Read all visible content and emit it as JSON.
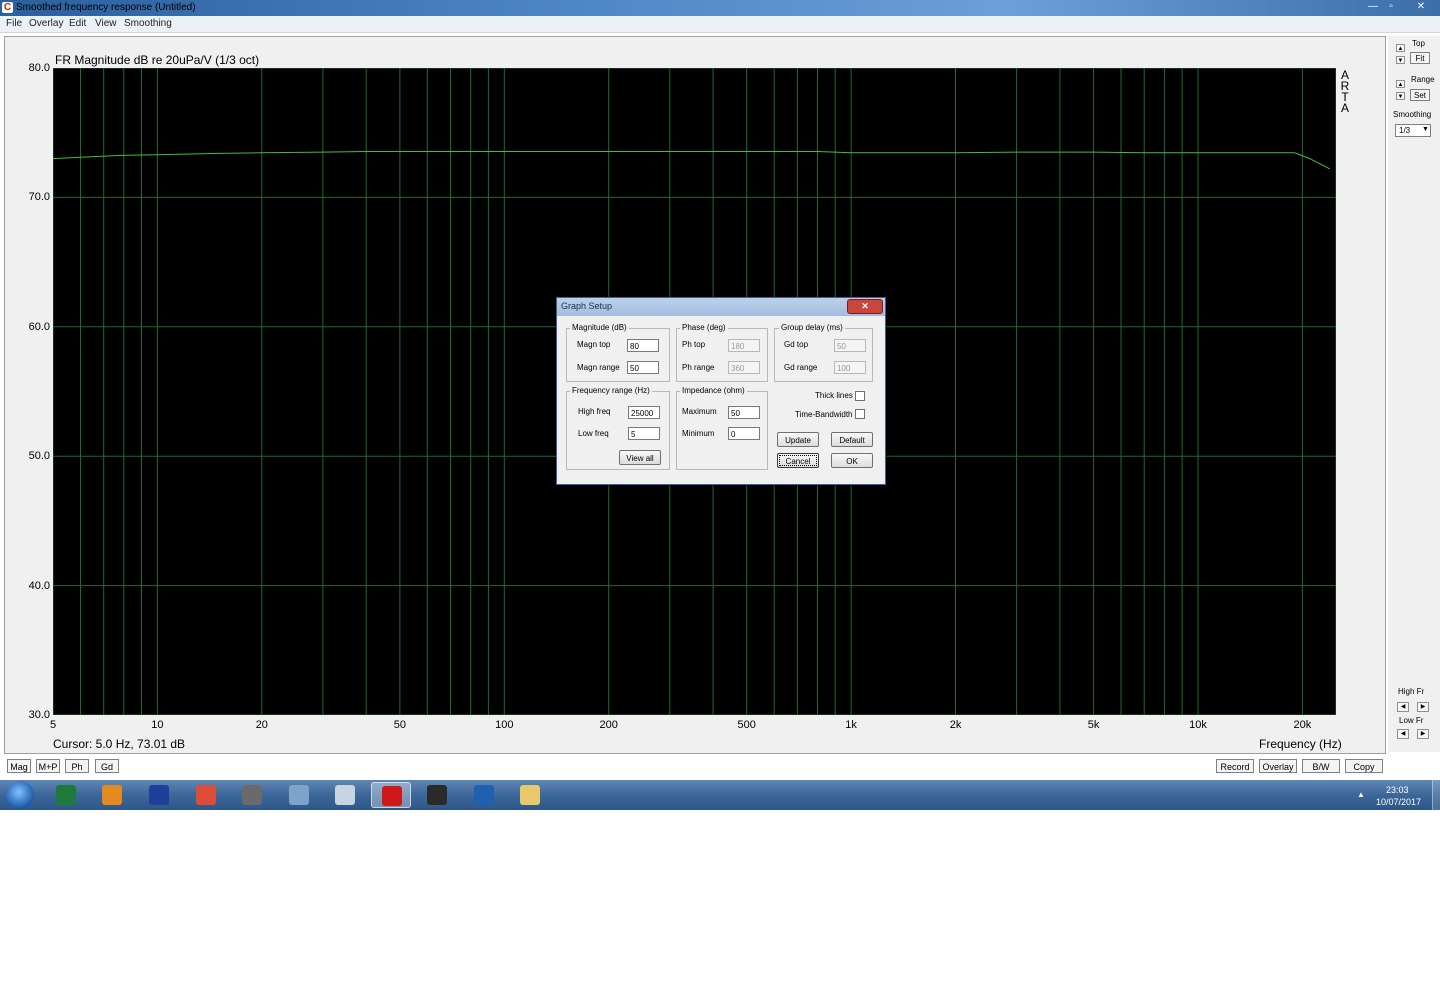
{
  "window": {
    "title": "Smoothed frequency response (Untitled)",
    "minimize": "—",
    "restore": "▫",
    "close": "✕"
  },
  "menu": [
    {
      "label": "File"
    },
    {
      "label": "Overlay"
    },
    {
      "label": "Edit"
    },
    {
      "label": "View"
    },
    {
      "label": "Smoothing"
    }
  ],
  "chart_data": {
    "type": "line",
    "title": "FR Magnitude dB re 20uPa/V (1/3 oct)",
    "xlabel": "Frequency (Hz)",
    "ylabel": "",
    "x_scale": "log",
    "xlim": [
      5,
      25000
    ],
    "ylim": [
      30,
      80
    ],
    "y_ticks": [
      "80.0",
      "70.0",
      "60.0",
      "50.0",
      "40.0",
      "30.0"
    ],
    "x_ticks": [
      {
        "value": 5,
        "label": "5"
      },
      {
        "value": 10,
        "label": "10"
      },
      {
        "value": 20,
        "label": "20"
      },
      {
        "value": 50,
        "label": "50"
      },
      {
        "value": 100,
        "label": "100"
      },
      {
        "value": 200,
        "label": "200"
      },
      {
        "value": 500,
        "label": "500"
      },
      {
        "value": 1000,
        "label": "1k"
      },
      {
        "value": 2000,
        "label": "2k"
      },
      {
        "value": 5000,
        "label": "5k"
      },
      {
        "value": 10000,
        "label": "10k"
      },
      {
        "value": 20000,
        "label": "20k"
      }
    ],
    "grid": true,
    "background": "#000000",
    "grid_color": "#1f6b2a",
    "line_color": "#3fbf3f",
    "series": [
      {
        "x": [
          5,
          6,
          8,
          10,
          15,
          20,
          30,
          40,
          60,
          100,
          200,
          300,
          500,
          800,
          1000,
          2000,
          3000,
          5000,
          7000,
          10000,
          15000,
          19000,
          21000,
          24000
        ],
        "values": [
          73.0,
          73.1,
          73.25,
          73.3,
          73.4,
          73.45,
          73.5,
          73.55,
          73.55,
          73.55,
          73.55,
          73.55,
          73.55,
          73.55,
          73.45,
          73.45,
          73.5,
          73.5,
          73.45,
          73.45,
          73.45,
          73.45,
          73.0,
          72.2
        ]
      }
    ]
  },
  "cursor_readout": "Cursor: 5.0 Hz, 73.01 dB",
  "watermark": [
    "A",
    "R",
    "T",
    "A"
  ],
  "right_panel": {
    "top_label": "Top",
    "fit_button": "Fit",
    "range_label": "Range",
    "set_button": "Set",
    "smoothing_label": "Smoothing",
    "smoothing_value": "1/3",
    "high_fr_label": "High Fr",
    "low_fr_label": "Low Fr"
  },
  "bottom_tabs": [
    {
      "label": "Mag"
    },
    {
      "label": "M+P"
    },
    {
      "label": "Ph"
    },
    {
      "label": "Gd"
    }
  ],
  "bottom_actions": [
    {
      "label": "Record"
    },
    {
      "label": "Overlay"
    },
    {
      "label": "B/W"
    },
    {
      "label": "Copy"
    }
  ],
  "dialog": {
    "title": "Graph Setup",
    "magnitude": {
      "label": "Magnitude (dB)",
      "top_label": "Magn top",
      "top_value": "80",
      "range_label": "Magn range",
      "range_value": "50"
    },
    "phase": {
      "label": "Phase (deg)",
      "top_label": "Ph top",
      "top_value": "180",
      "range_label": "Ph range",
      "range_value": "360"
    },
    "group_delay": {
      "label": "Group delay (ms)",
      "top_label": "Gd top",
      "top_value": "50",
      "range_label": "Gd range",
      "range_value": "100"
    },
    "frequency": {
      "label": "Frequency range (Hz)",
      "high_label": "High freq",
      "high_value": "25000",
      "low_label": "Low freq",
      "low_value": "5",
      "view_all": "View all"
    },
    "impedance": {
      "label": "Impedance (ohm)",
      "max_label": "Maximum",
      "max_value": "50",
      "min_label": "Minimum",
      "min_value": "0"
    },
    "thick_lines_label": "Thick lines",
    "thick_lines_checked": false,
    "time_bandwidth_label": "Time-Bandwidth",
    "time_bandwidth_checked": false,
    "update_button": "Update",
    "default_button": "Default",
    "cancel_button": "Cancel",
    "ok_button": "OK"
  },
  "taskbar": {
    "apps": [
      {
        "icon": "excel-icon",
        "color": "#1e7a3c"
      },
      {
        "icon": "media-player-icon",
        "color": "#e58a1f"
      },
      {
        "icon": "word-icon",
        "color": "#1f3f9a"
      },
      {
        "icon": "chrome-icon",
        "color": "#dd4b39"
      },
      {
        "icon": "photo-app-icon",
        "color": "#6a6a6a"
      },
      {
        "icon": "calculator-icon",
        "color": "#7fa3c8"
      },
      {
        "icon": "speaker-app-icon",
        "color": "#c8d4e0"
      },
      {
        "icon": "arta-icon",
        "color": "#d01818"
      },
      {
        "icon": "speaker-box-icon",
        "color": "#2a2a2a"
      },
      {
        "icon": "measurement-app-icon",
        "color": "#2060b0"
      },
      {
        "icon": "file-explorer-icon",
        "color": "#e8c86a"
      }
    ],
    "tray_arrow": "▲",
    "time": "23:03",
    "date": "10/07/2017"
  }
}
